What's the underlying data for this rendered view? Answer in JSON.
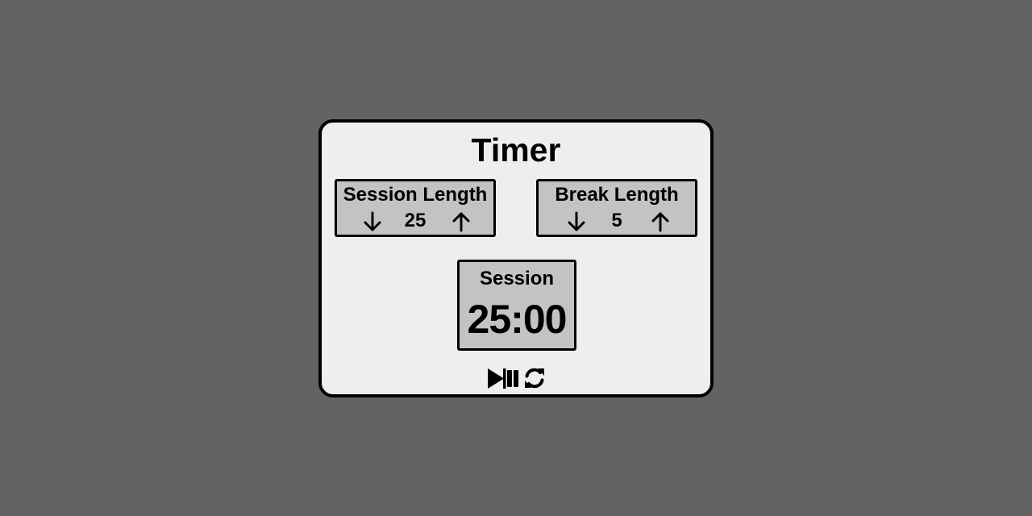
{
  "card": {
    "title": "Timer"
  },
  "session_length": {
    "label": "Session Length",
    "value": "25",
    "decrement_icon": "arrow-down-icon",
    "increment_icon": "arrow-up-icon"
  },
  "break_length": {
    "label": "Break Length",
    "value": "5",
    "decrement_icon": "arrow-down-icon",
    "increment_icon": "arrow-up-icon"
  },
  "display": {
    "label": "Session",
    "time": "25:00"
  },
  "controls": {
    "play_pause_icon": "play-pause-icon",
    "reset_icon": "refresh-icon"
  },
  "colors": {
    "background": "#626262",
    "card": "#eeeeec",
    "panel": "#c3c3c3",
    "text": "#000000"
  }
}
